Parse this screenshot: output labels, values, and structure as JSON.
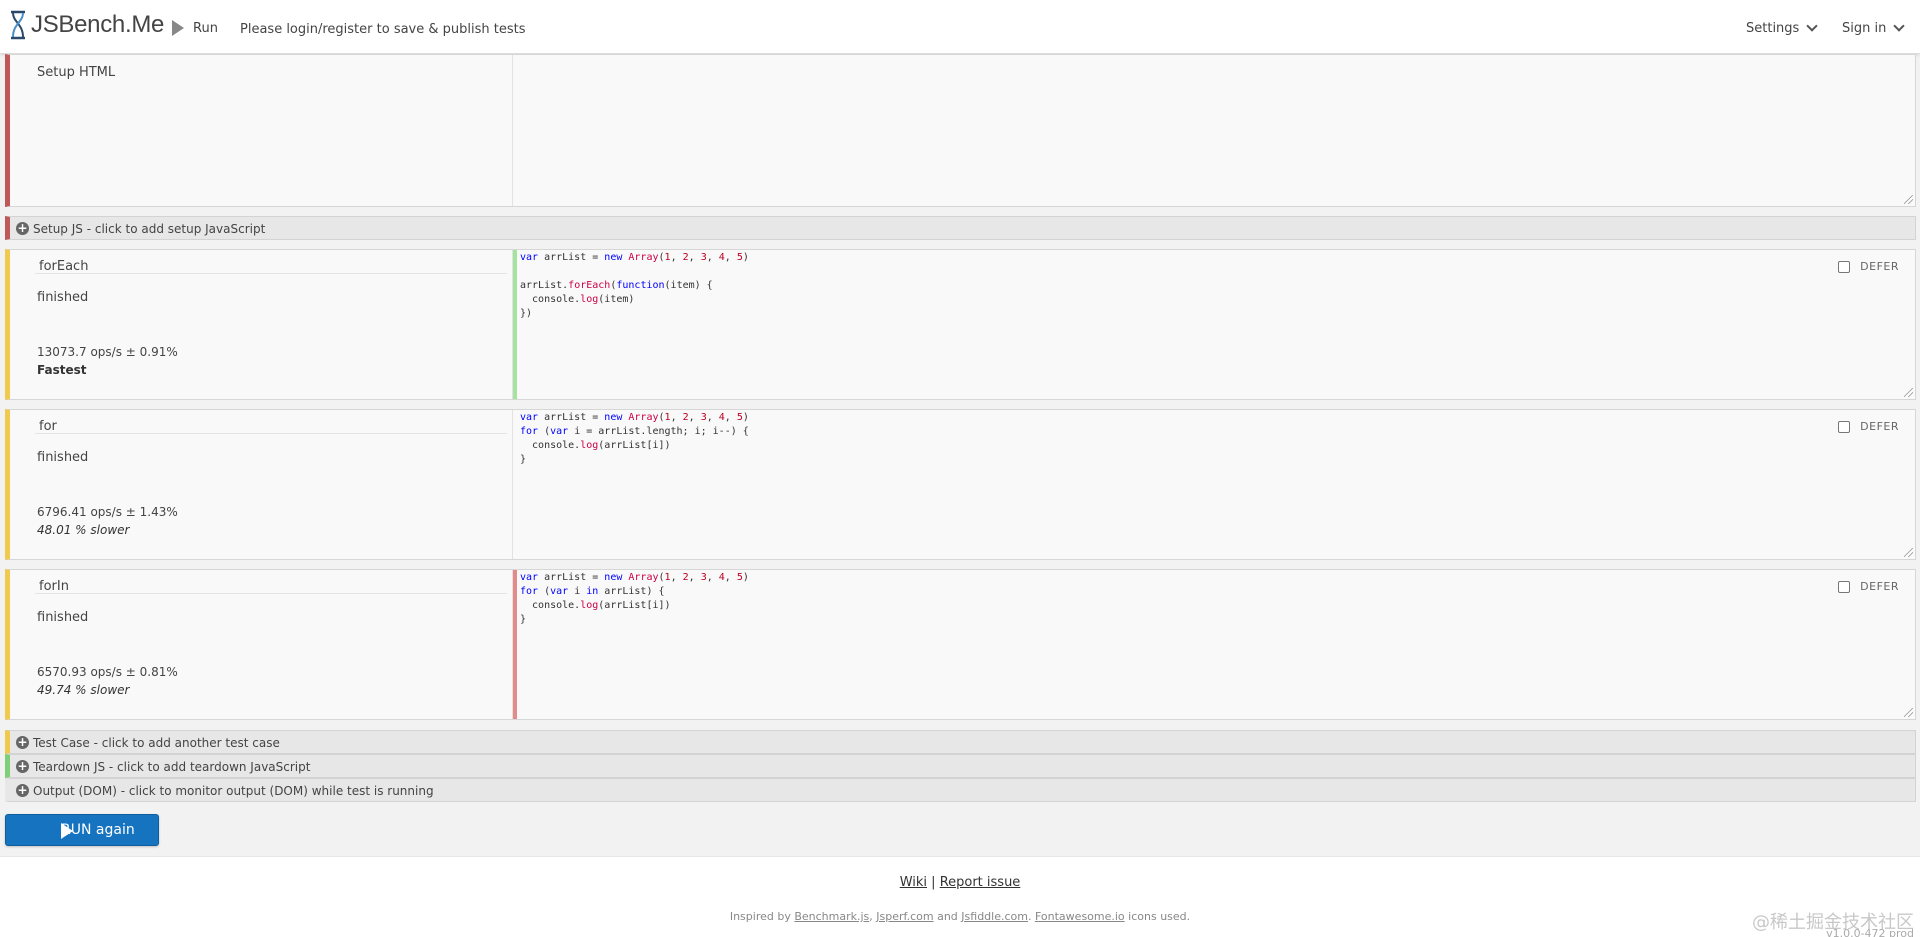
{
  "header": {
    "brand": "JSBench.Me",
    "run_label": "Run",
    "message": "Please login/register to save & publish tests",
    "settings_label": "Settings",
    "signin_label": "Sign in"
  },
  "setup_html": {
    "label": "Setup HTML"
  },
  "setup_js": {
    "label": "Setup JS - click to add setup JavaScript"
  },
  "tests": [
    {
      "name": "forEach",
      "status": "finished",
      "ops": "13073.7 ops/s ± 0.91%",
      "rank": "Fastest",
      "defer": "DEFER"
    },
    {
      "name": "for",
      "status": "finished",
      "ops": "6796.41 ops/s ± 1.43%",
      "rank": "48.01 % slower",
      "defer": "DEFER"
    },
    {
      "name": "forIn",
      "status": "finished",
      "ops": "6570.93 ops/s ± 0.81%",
      "rank": "49.74 % slower",
      "defer": "DEFER"
    }
  ],
  "bars": {
    "test_case": "Test Case - click to add another test case",
    "teardown": "Teardown JS - click to add teardown JavaScript",
    "output": "Output (DOM) - click to monitor output (DOM) while test is running"
  },
  "run_again": "RUN again",
  "footer": {
    "wiki": "Wiki",
    "separator": "|",
    "report": "Report issue",
    "inspired": "Inspired by",
    "benchmark": "Benchmark.js",
    "jsperf": "Jsperf.com",
    "and": "and",
    "jsfiddle": "Jsfiddle.com",
    "fontawesome": "Fontawesome.io",
    "icons_used": "icons used.",
    "watermark": "@稀土掘金技术社区",
    "version": "v1.0.0-472 prod"
  },
  "colors": {
    "setup_border": "#c0585a",
    "test_border": "#f0c94d",
    "teardown_border": "#7fcf7a",
    "run_button": "#1573c0",
    "fastest_code_marker": "#a6e3a1",
    "slowest_code_marker": "#e38b8b"
  }
}
